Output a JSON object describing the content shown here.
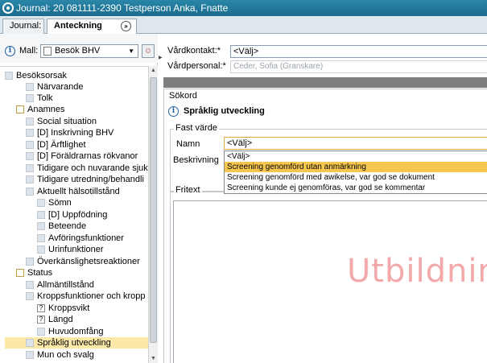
{
  "window": {
    "title": "Journal: 20 081111-2390 Testperson Anka, Fnatte"
  },
  "tabs": [
    {
      "label": "Journal:"
    },
    {
      "label": "Anteckning"
    }
  ],
  "left_panel": {
    "mall_label": "Mall:",
    "mall_value": "Besök BHV",
    "tree": [
      {
        "label": "Besöksorsak"
      },
      {
        "label": "Närvarande"
      },
      {
        "label": "Tolk"
      },
      {
        "label": "Anamnes"
      },
      {
        "label": "Social situation"
      },
      {
        "label": "[D] Inskrivning BHV"
      },
      {
        "label": "[D] Ärftlighet"
      },
      {
        "label": "[D] Föräldrarnas rökvanor"
      },
      {
        "label": "Tidigare och nuvarande sjuk"
      },
      {
        "label": "Tidigare utredning/behandli"
      },
      {
        "label": "Aktuellt hälsotillstånd"
      },
      {
        "label": "Sömn"
      },
      {
        "label": "[D] Uppfödning"
      },
      {
        "label": "Beteende"
      },
      {
        "label": "Avföringsfunktioner"
      },
      {
        "label": "Urinfunktioner"
      },
      {
        "label": "Överkänslighetsreaktioner"
      },
      {
        "label": "Status"
      },
      {
        "label": "Allmäntillstånd"
      },
      {
        "label": "Kroppsfunktioner och kropp"
      },
      {
        "label": "Kroppsvikt"
      },
      {
        "label": "Längd"
      },
      {
        "label": "Huvudomfång"
      },
      {
        "label": "Språklig utveckling"
      },
      {
        "label": "Mun och svalg"
      }
    ]
  },
  "right_panel": {
    "vardkontakt_label": "Vårdkontakt:*",
    "vardkontakt_value": "<Välj>",
    "vardpersonal_label": "Vårdpersonal:*",
    "vardpersonal_value": "Ceder, Sofia (Granskare)",
    "sokord_label": "Sökord",
    "sokord_title": "Språklig utveckling",
    "fast_varde_label": "Fast värde",
    "namn_label": "Namn",
    "namn_value": "<Välj>",
    "beskrivning_label": "Beskrivning",
    "dropdown_options": [
      "<Välj>",
      "Screening genomförd utan anmärkning",
      "Screening genomförd med awikelse, var god se dokument",
      "Screening kunde ej genomföras, var god se kommentar"
    ],
    "fritext_label": "Fritext",
    "watermark": "Utbildnin"
  }
}
